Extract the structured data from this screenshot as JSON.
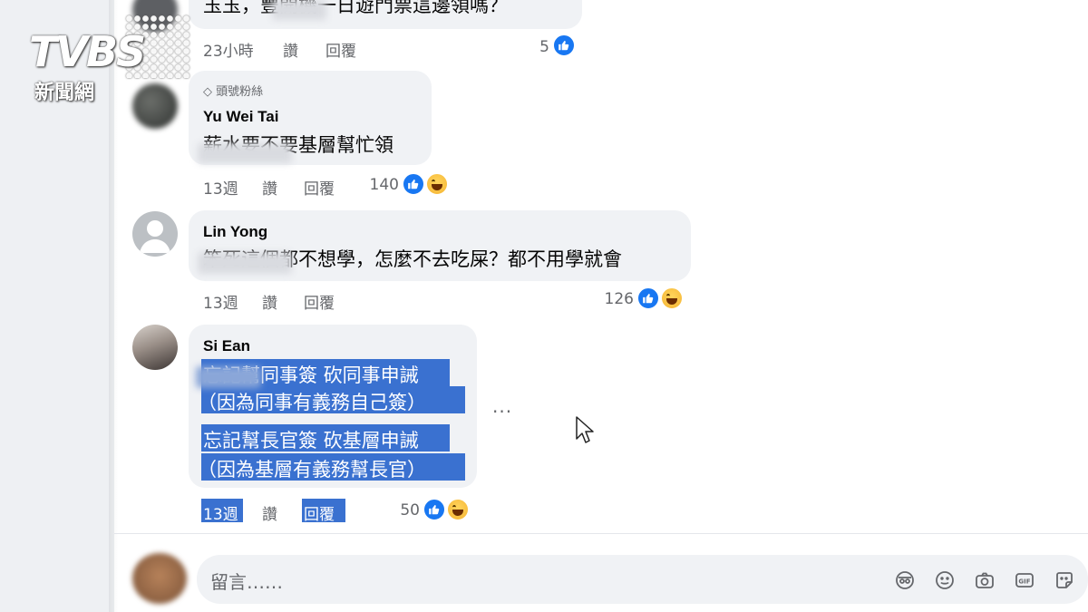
{
  "watermark": {
    "brand": "TVBS",
    "subtitle": "新聞網"
  },
  "comments": [
    {
      "id": "c0",
      "text_partial": "玉玉，豐開機一日遊門票這邊領嗎？",
      "time": "23小時",
      "like_label": "讚",
      "reply_label": "回覆",
      "reaction_count": "5"
    },
    {
      "id": "c1",
      "badge": "頭號粉絲",
      "author": "Yu Wei Tai",
      "text": "薪水要不要基層幫忙領",
      "time": "13週",
      "like_label": "讚",
      "reply_label": "回覆",
      "reaction_count": "140"
    },
    {
      "id": "c2",
      "author": "Lin Yong",
      "text": "笨死這個都不想學，怎麼不去吃屎？都不用學就會",
      "time": "13週",
      "like_label": "讚",
      "reply_label": "回覆",
      "reaction_count": "126"
    },
    {
      "id": "c3",
      "author": "Si Ean",
      "lines": [
        "忘記幫同事簽 砍同事申誡",
        "（因為同事有義務自己簽）",
        "忘記幫長官簽 砍基層申誡",
        "（因為基層有義務幫長官）"
      ],
      "time": "13週",
      "like_label": "讚",
      "reply_label": "回覆",
      "reaction_count": "50",
      "more_label": "..."
    }
  ],
  "composer": {
    "placeholder": "留言……"
  },
  "composer_tools": [
    "avatar-sticker-icon",
    "emoji-icon",
    "camera-icon",
    "gif-icon",
    "sticker-icon"
  ],
  "colors": {
    "selection": "#3a71d0",
    "like": "#1877f2",
    "bubble": "#f0f2f5"
  }
}
